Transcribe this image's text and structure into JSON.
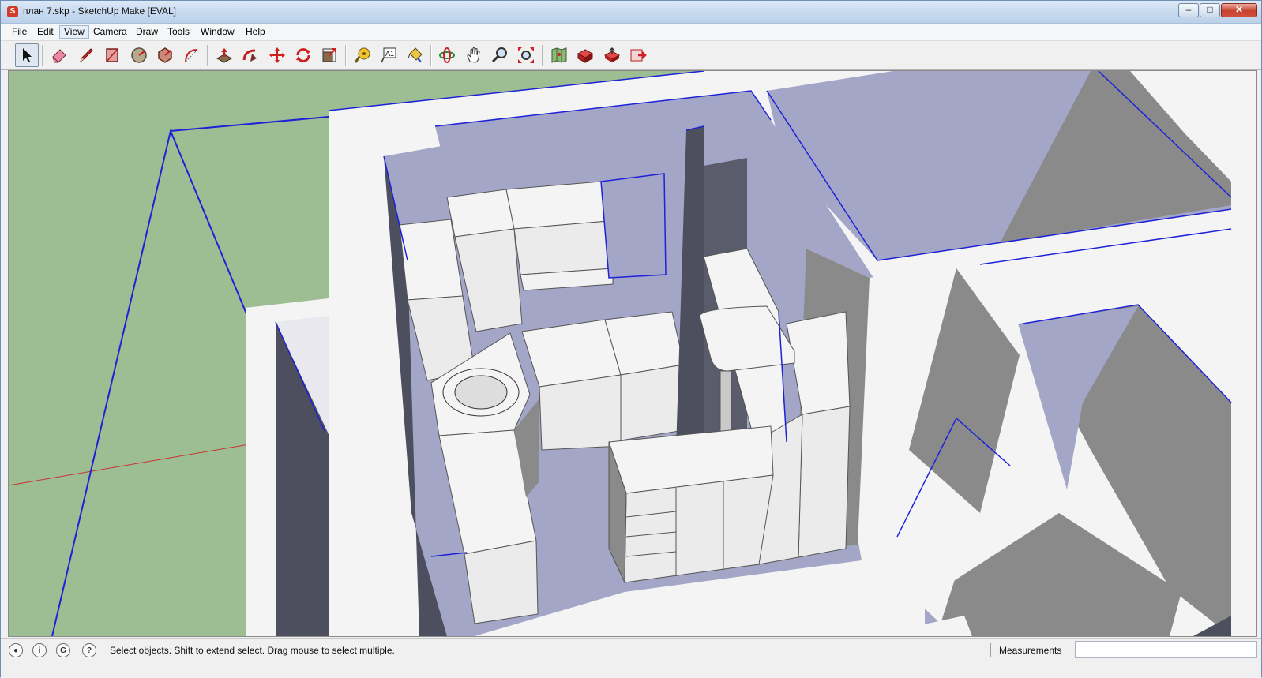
{
  "window": {
    "title": "план 7.skp - SketchUp Make [EVAL]",
    "app_icon": "sketchup-logo-icon",
    "controls": {
      "minimize": "minimize-icon",
      "maximize": "maximize-icon",
      "close": "close-icon"
    }
  },
  "menubar": {
    "items": [
      {
        "label": "File"
      },
      {
        "label": "Edit"
      },
      {
        "label": "View",
        "active": true
      },
      {
        "label": "Camera"
      },
      {
        "label": "Draw"
      },
      {
        "label": "Tools"
      },
      {
        "label": "Window"
      },
      {
        "label": "Help"
      }
    ]
  },
  "toolbar": {
    "tools": [
      {
        "name": "select-tool",
        "icon": "arrow-icon",
        "selected": true
      },
      {
        "name": "eraser-tool",
        "icon": "eraser-icon"
      },
      {
        "name": "line-tool",
        "icon": "pencil-icon"
      },
      {
        "name": "rectangle-tool",
        "icon": "rectangle-icon"
      },
      {
        "name": "circle-tool",
        "icon": "circle-icon"
      },
      {
        "name": "polygon-tool",
        "icon": "polygon-icon"
      },
      {
        "name": "arc-tool",
        "icon": "arc-icon"
      },
      {
        "name": "push-pull-tool",
        "icon": "push-pull-icon"
      },
      {
        "name": "follow-me-tool",
        "icon": "follow-me-icon"
      },
      {
        "name": "move-tool",
        "icon": "move-icon"
      },
      {
        "name": "rotate-tool",
        "icon": "rotate-icon"
      },
      {
        "name": "scale-tool",
        "icon": "scale-icon"
      },
      {
        "name": "tape-measure-tool",
        "icon": "tape-measure-icon"
      },
      {
        "name": "text-tool",
        "icon": "text-icon",
        "glyph": "A1"
      },
      {
        "name": "paint-bucket-tool",
        "icon": "paint-bucket-icon"
      },
      {
        "name": "orbit-tool",
        "icon": "orbit-icon"
      },
      {
        "name": "pan-tool",
        "icon": "hand-icon"
      },
      {
        "name": "zoom-tool",
        "icon": "magnifier-icon"
      },
      {
        "name": "zoom-extents-tool",
        "icon": "zoom-extents-icon"
      },
      {
        "name": "add-location-tool",
        "icon": "map-icon"
      },
      {
        "name": "get-models-tool",
        "icon": "3d-warehouse-icon"
      },
      {
        "name": "share-model-tool",
        "icon": "share-model-icon"
      },
      {
        "name": "extension-warehouse-tool",
        "icon": "extension-icon"
      }
    ]
  },
  "status": {
    "icons": [
      "geo-location-icon",
      "credits-icon",
      "user-icon",
      "help-icon"
    ],
    "message": "Select objects. Shift to extend select. Drag mouse to select multiple.",
    "measurements_label": "Measurements",
    "measurements_value": ""
  },
  "colors": {
    "ground": "#9dbd92",
    "floor": "#a3a6c6",
    "wall_top": "#f4f4f4",
    "wall_side_dark": "#4d4f5e",
    "wall_side_gray": "#8a8a8a",
    "edge_blue": "#1d22d8",
    "axis_red": "#c8332f"
  }
}
